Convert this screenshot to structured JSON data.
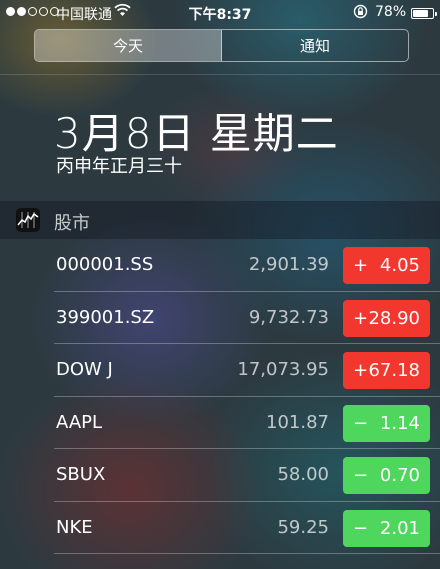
{
  "status_bar": {
    "carrier": "中国联通",
    "time": "下午8:37",
    "battery_percent": "78%",
    "signal_strength_dots": 2,
    "battery_level": 0.78
  },
  "tabs": [
    {
      "label": "今天",
      "active": true
    },
    {
      "label": "通知",
      "active": false
    }
  ],
  "date": {
    "main": "3月8日 星期二",
    "lunar": "丙申年正月三十"
  },
  "widget": {
    "title": "股市",
    "icon": "stocks-icon"
  },
  "stocks": [
    {
      "symbol": "000001.SS",
      "price": "2,901.39",
      "sign": "+",
      "change": "4.05",
      "direction": "up"
    },
    {
      "symbol": "399001.SZ",
      "price": "9,732.73",
      "sign": "+",
      "change": "28.90",
      "direction": "up"
    },
    {
      "symbol": "DOW J",
      "price": "17,073.95",
      "sign": "+",
      "change": "67.18",
      "direction": "up"
    },
    {
      "symbol": "AAPL",
      "price": "101.87",
      "sign": "−",
      "change": "1.14",
      "direction": "down"
    },
    {
      "symbol": "SBUX",
      "price": "58.00",
      "sign": "−",
      "change": "0.70",
      "direction": "down"
    },
    {
      "symbol": "NKE",
      "price": "59.25",
      "sign": "−",
      "change": "2.01",
      "direction": "down"
    }
  ],
  "colors": {
    "up": "#f2372f",
    "down": "#4fd65c"
  }
}
